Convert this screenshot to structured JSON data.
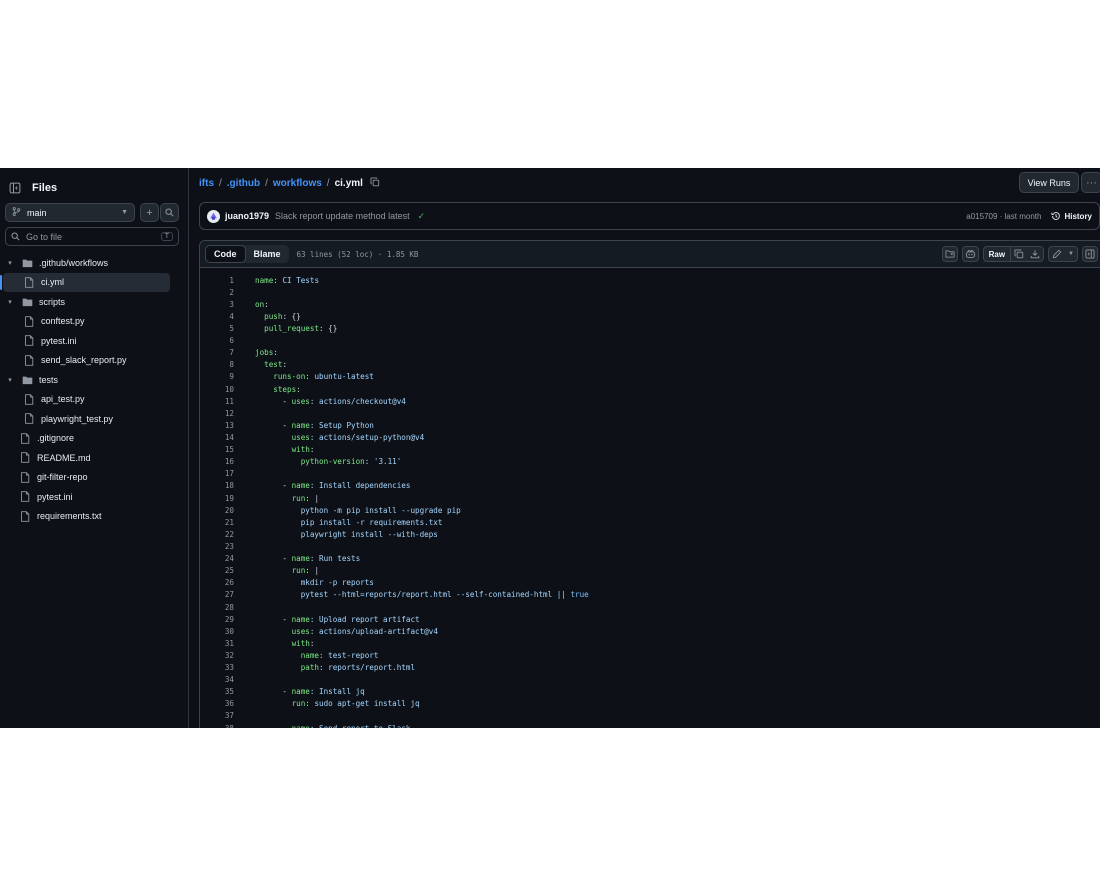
{
  "sidebar": {
    "title": "Files",
    "branch": "main",
    "search_placeholder": "Go to file",
    "search_shortcut": "T",
    "tree": [
      {
        "label": ".github/workflows",
        "type": "folder",
        "depth": 0,
        "expanded": true
      },
      {
        "label": "ci.yml",
        "type": "file",
        "depth": 1,
        "selected": true
      },
      {
        "label": "scripts",
        "type": "folder",
        "depth": 0,
        "expanded": true
      },
      {
        "label": "conftest.py",
        "type": "file",
        "depth": 1
      },
      {
        "label": "pytest.ini",
        "type": "file",
        "depth": 1
      },
      {
        "label": "send_slack_report.py",
        "type": "file",
        "depth": 1
      },
      {
        "label": "tests",
        "type": "folder",
        "depth": 0,
        "expanded": true
      },
      {
        "label": "api_test.py",
        "type": "file",
        "depth": 1
      },
      {
        "label": "playwright_test.py",
        "type": "file",
        "depth": 1
      },
      {
        "label": ".gitignore",
        "type": "file",
        "depth": 0
      },
      {
        "label": "README.md",
        "type": "file",
        "depth": 0
      },
      {
        "label": "git-filter-repo",
        "type": "file",
        "depth": 0
      },
      {
        "label": "pytest.ini",
        "type": "file",
        "depth": 0
      },
      {
        "label": "requirements.txt",
        "type": "file",
        "depth": 0
      }
    ]
  },
  "breadcrumb": {
    "repo": "ifts",
    "dir1": ".github",
    "dir2": "workflows",
    "file": "ci.yml",
    "sep": "/"
  },
  "header": {
    "view_runs": "View Runs",
    "more": "···"
  },
  "commit": {
    "author": "juano1979",
    "message": "Slack report update method latest",
    "hash": "a015709",
    "sep": " · ",
    "time": "last month",
    "history": "History"
  },
  "fileview": {
    "tab_code": "Code",
    "tab_blame": "Blame",
    "info": "63 lines (52 loc) · 1.85 KB",
    "raw": "Raw"
  },
  "code_lines": [
    [
      {
        "t": "name",
        "c": "k"
      },
      {
        "t": ": CI Tests",
        "c": "s"
      }
    ],
    [],
    [
      {
        "t": "on",
        "c": "k"
      },
      {
        "t": ":",
        "c": ""
      }
    ],
    [
      {
        "t": "  push",
        "c": "k"
      },
      {
        "t": ": {}",
        "c": ""
      }
    ],
    [
      {
        "t": "  pull_request",
        "c": "k"
      },
      {
        "t": ": {}",
        "c": ""
      }
    ],
    [],
    [
      {
        "t": "jobs",
        "c": "k"
      },
      {
        "t": ":",
        "c": ""
      }
    ],
    [
      {
        "t": "  test",
        "c": "k"
      },
      {
        "t": ":",
        "c": ""
      }
    ],
    [
      {
        "t": "    runs-on",
        "c": "k"
      },
      {
        "t": ": ubuntu-latest",
        "c": "s"
      }
    ],
    [
      {
        "t": "    steps",
        "c": "k"
      },
      {
        "t": ":",
        "c": ""
      }
    ],
    [
      {
        "t": "      - ",
        "c": ""
      },
      {
        "t": "uses",
        "c": "k"
      },
      {
        "t": ": actions/checkout@v4",
        "c": "s"
      }
    ],
    [],
    [
      {
        "t": "      - ",
        "c": ""
      },
      {
        "t": "name",
        "c": "k"
      },
      {
        "t": ": Setup Python",
        "c": "s"
      }
    ],
    [
      {
        "t": "        uses",
        "c": "k"
      },
      {
        "t": ": actions/setup-python@v4",
        "c": "s"
      }
    ],
    [
      {
        "t": "        with",
        "c": "k"
      },
      {
        "t": ":",
        "c": ""
      }
    ],
    [
      {
        "t": "          python-version",
        "c": "k"
      },
      {
        "t": ": '3.11'",
        "c": "s"
      }
    ],
    [],
    [
      {
        "t": "      - ",
        "c": ""
      },
      {
        "t": "name",
        "c": "k"
      },
      {
        "t": ": Install dependencies",
        "c": "s"
      }
    ],
    [
      {
        "t": "        run",
        "c": "k"
      },
      {
        "t": ": |",
        "c": ""
      }
    ],
    [
      {
        "t": "          python -m pip install --upgrade pip",
        "c": "s"
      }
    ],
    [
      {
        "t": "          pip install -r requirements.txt",
        "c": "s"
      }
    ],
    [
      {
        "t": "          playwright install --with-deps",
        "c": "s"
      }
    ],
    [],
    [
      {
        "t": "      - ",
        "c": ""
      },
      {
        "t": "name",
        "c": "k"
      },
      {
        "t": ": Run tests",
        "c": "s"
      }
    ],
    [
      {
        "t": "        run",
        "c": "k"
      },
      {
        "t": ": |",
        "c": ""
      }
    ],
    [
      {
        "t": "          mkdir -p reports",
        "c": "s"
      }
    ],
    [
      {
        "t": "          pytest --html=reports/report.html --self-contained-html || ",
        "c": "s"
      },
      {
        "t": "true",
        "c": "b"
      }
    ],
    [],
    [
      {
        "t": "      - ",
        "c": ""
      },
      {
        "t": "name",
        "c": "k"
      },
      {
        "t": ": Upload report artifact",
        "c": "s"
      }
    ],
    [
      {
        "t": "        uses",
        "c": "k"
      },
      {
        "t": ": actions/upload-artifact@v4",
        "c": "s"
      }
    ],
    [
      {
        "t": "        with",
        "c": "k"
      },
      {
        "t": ":",
        "c": ""
      }
    ],
    [
      {
        "t": "          name",
        "c": "k"
      },
      {
        "t": ": test-report",
        "c": "s"
      }
    ],
    [
      {
        "t": "          path",
        "c": "k"
      },
      {
        "t": ": reports/report.html",
        "c": "s"
      }
    ],
    [],
    [
      {
        "t": "      - ",
        "c": ""
      },
      {
        "t": "name",
        "c": "k"
      },
      {
        "t": ": Install jq",
        "c": "s"
      }
    ],
    [
      {
        "t": "        run",
        "c": "k"
      },
      {
        "t": ": sudo apt-get install jq",
        "c": "s"
      }
    ],
    [],
    [
      {
        "t": "      - ",
        "c": ""
      },
      {
        "t": "name",
        "c": "k"
      },
      {
        "t": ": Send report to Slack",
        "c": "s"
      }
    ]
  ]
}
